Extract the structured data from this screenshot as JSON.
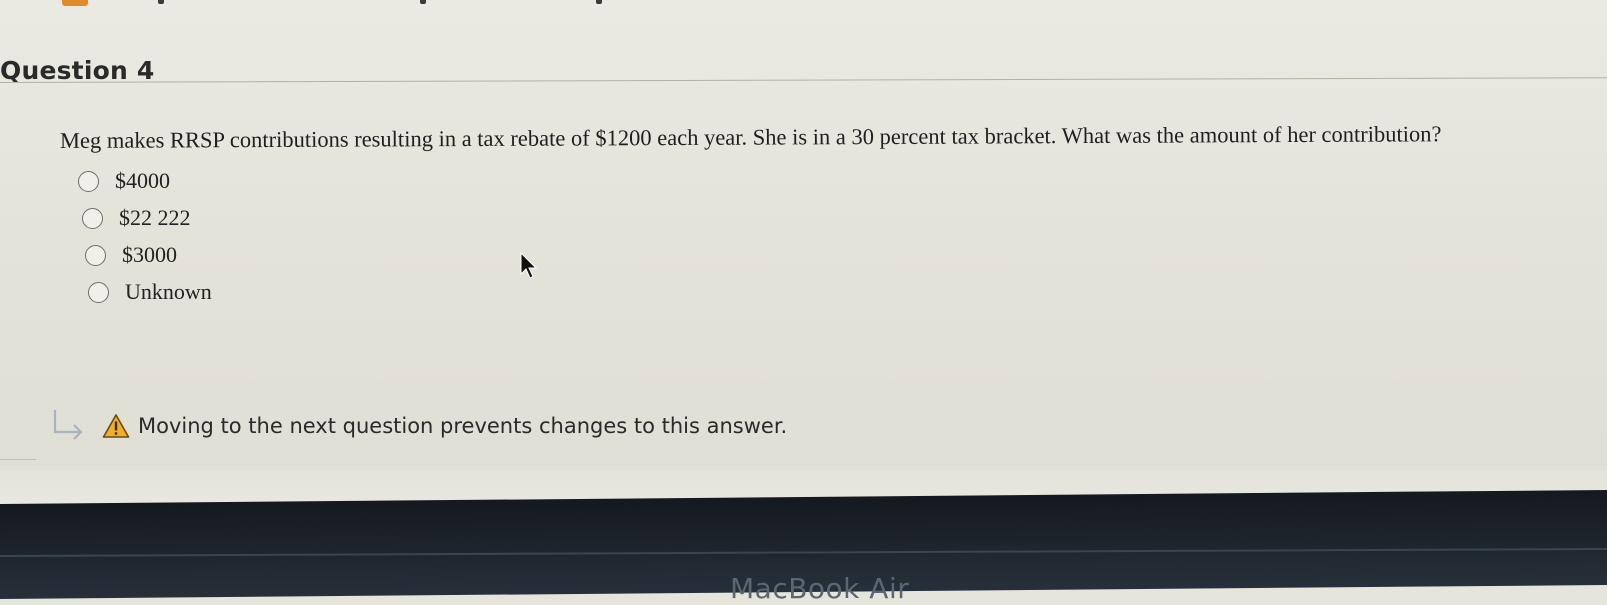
{
  "question": {
    "title": "Question 4",
    "text": "Meg makes RRSP contributions resulting in a tax rebate of $1200 each year. She is in a 30 percent tax bracket. What was the amount of her contribution?",
    "options": [
      {
        "label": "$4000",
        "selected": false
      },
      {
        "label": "$22 222",
        "selected": false
      },
      {
        "label": "$3000",
        "selected": false
      },
      {
        "label": "Unknown",
        "selected": false
      }
    ]
  },
  "warning": {
    "text": "Moving to the next question prevents changes to this answer.",
    "icon": "warning-triangle-icon",
    "arrow_icon": "next-arrow-icon",
    "color": "#e8a321"
  },
  "device": {
    "label": "MacBook Air"
  },
  "cursor": {
    "icon": "mouse-pointer-icon"
  }
}
